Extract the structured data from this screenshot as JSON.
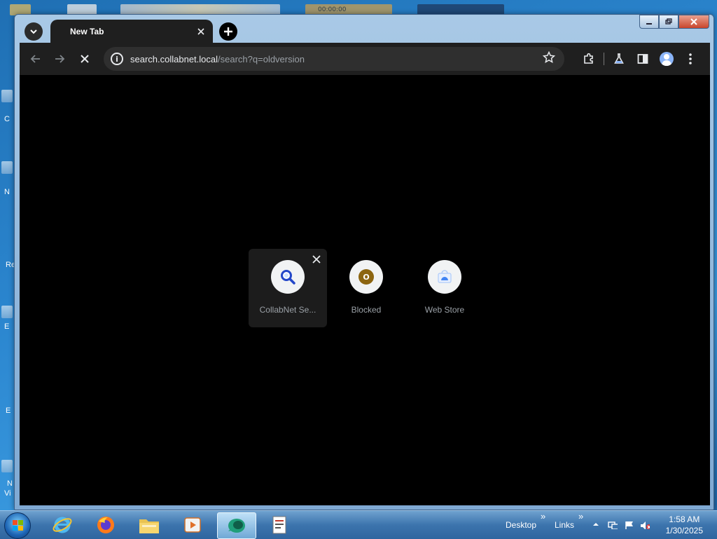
{
  "desktop": {
    "side_letters": [
      "C",
      "N",
      "Re",
      "E",
      "E",
      "N",
      "Vi"
    ],
    "thumb_time": "00:00:00"
  },
  "browser": {
    "tab": {
      "title": "New Tab"
    },
    "omnibox": {
      "host": "search.collabnet.local",
      "path": "/search?q=oldversion"
    }
  },
  "shortcuts": [
    {
      "label": "CollabNet Se...",
      "icon": "magnifier-icon",
      "hovered": true
    },
    {
      "label": "Blocked",
      "icon": "letter-o-icon",
      "letter": "O"
    },
    {
      "label": "Web Store",
      "icon": "web-store-icon"
    }
  ],
  "taskbar": {
    "toolbars": [
      "Desktop",
      "Links"
    ],
    "chevron": "»",
    "time": "1:58 AM",
    "date": "1/30/2025"
  },
  "colors": {
    "accent_blue": "#8ab4f8",
    "blocked_dot": "#8c6510",
    "page_background": "#000000",
    "toolbar_background": "#1f1f1f"
  }
}
